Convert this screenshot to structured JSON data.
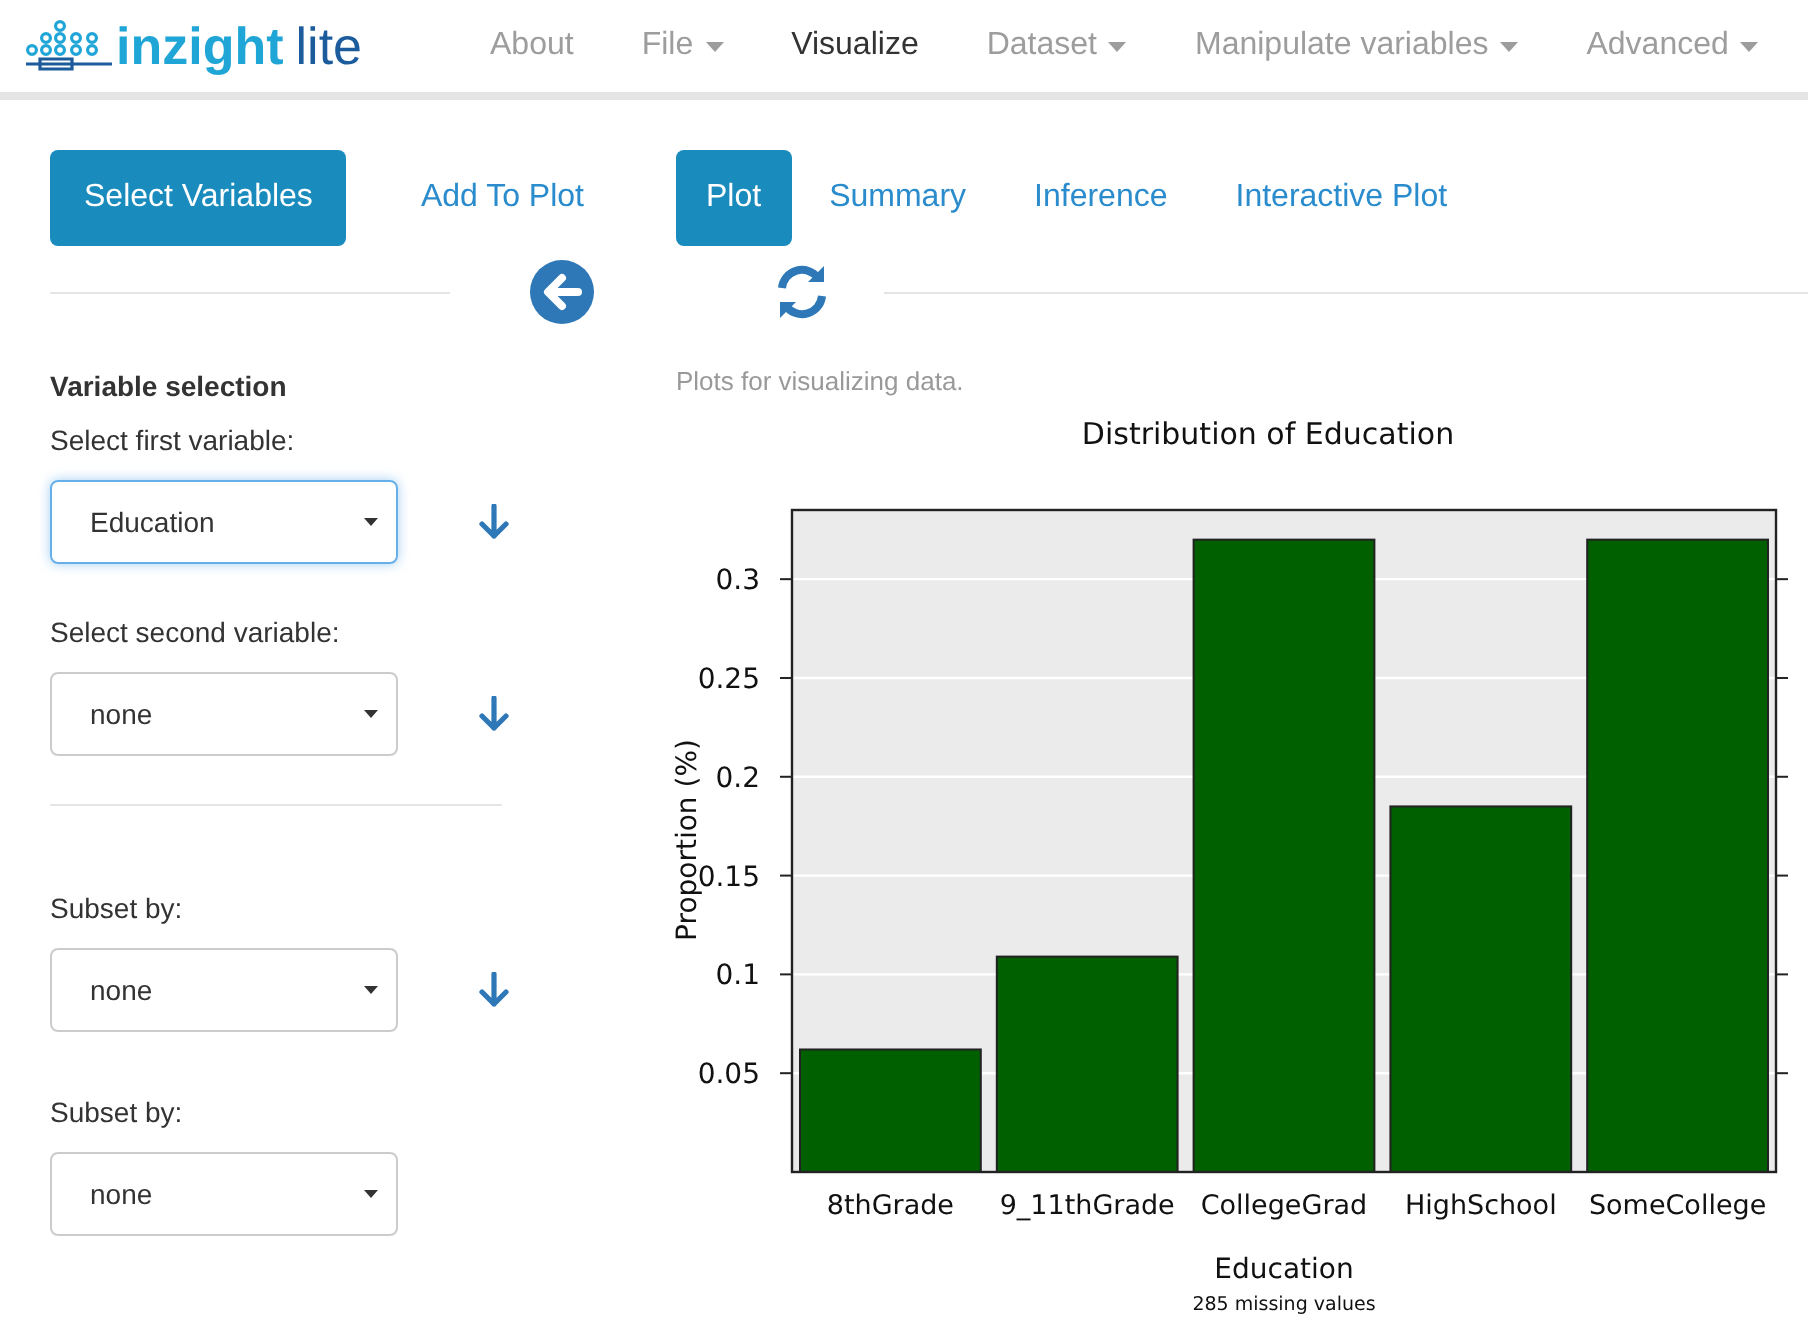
{
  "brand": {
    "name": "inzight",
    "suffix": "lite"
  },
  "nav": [
    {
      "label": "About",
      "dropdown": false,
      "selected": false
    },
    {
      "label": "File",
      "dropdown": true,
      "selected": false
    },
    {
      "label": "Visualize",
      "dropdown": false,
      "selected": true
    },
    {
      "label": "Dataset",
      "dropdown": true,
      "selected": false
    },
    {
      "label": "Manipulate variables",
      "dropdown": true,
      "selected": false
    },
    {
      "label": "Advanced",
      "dropdown": true,
      "selected": false
    }
  ],
  "left_tabs": [
    {
      "label": "Select Variables",
      "selected": true
    },
    {
      "label": "Add To Plot",
      "selected": false
    }
  ],
  "plot_tabs": [
    {
      "label": "Plot",
      "selected": true
    },
    {
      "label": "Summary",
      "selected": false
    },
    {
      "label": "Inference",
      "selected": false
    },
    {
      "label": "Interactive Plot",
      "selected": false
    }
  ],
  "sidebar": {
    "heading": "Variable selection",
    "fields": [
      {
        "label": "Select first variable:",
        "value": "Education",
        "focused": true
      },
      {
        "label": "Select second variable:",
        "value": "none",
        "focused": false
      },
      {
        "label": "Subset by:",
        "value": "none",
        "focused": false
      },
      {
        "label": "Subset by:",
        "value": "none",
        "focused": false
      }
    ]
  },
  "description": "Plots for visualizing data.",
  "chart_data": {
    "type": "bar",
    "title": "Distribution of Education",
    "xlabel": "Education",
    "ylabel": "Proportion (%)",
    "annotations": [
      "285 missing values"
    ],
    "grid": true,
    "categories": [
      "8thGrade",
      "9_11thGrade",
      "CollegeGrad",
      "HighSchool",
      "SomeCollege"
    ],
    "series": [
      {
        "color": "#006000",
        "values": [
          0.062,
          0.109,
          0.32,
          0.185,
          0.32
        ]
      }
    ],
    "ylim": [
      0,
      0.335
    ],
    "yticks": [
      0.05,
      0.1,
      0.15,
      0.2,
      0.25,
      0.3
    ]
  }
}
